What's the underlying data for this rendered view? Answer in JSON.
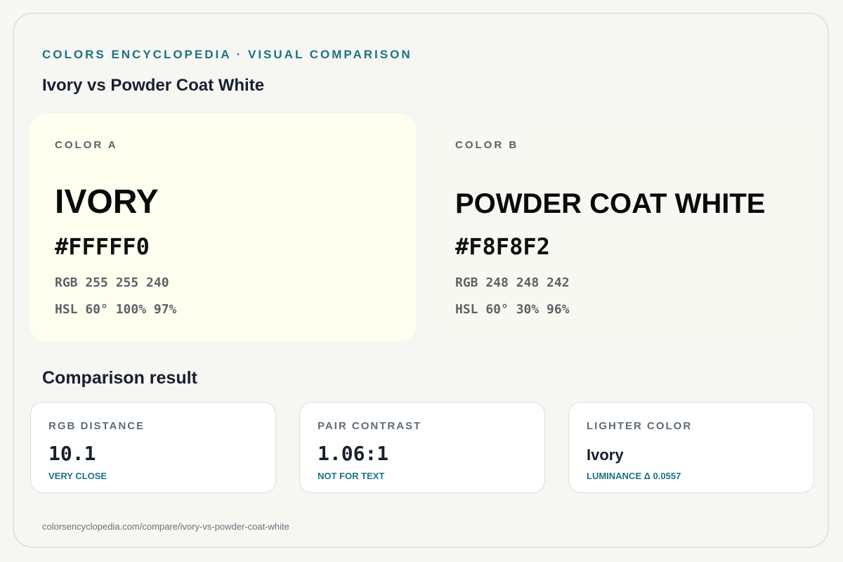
{
  "header": {
    "kicker": "COLORS ENCYCLOPEDIA · VISUAL COMPARISON",
    "title": "Ivory vs Powder Coat White"
  },
  "colors": [
    {
      "label": "COLOR A",
      "name": "IVORY",
      "hex": "#FFFFF0",
      "rgb": "RGB 255 255 240",
      "hsl": "HSL 60° 100% 97%",
      "swatch_color": "#FFFFF0"
    },
    {
      "label": "COLOR B",
      "name": "POWDER COAT WHITE",
      "hex": "#F8F8F2",
      "rgb": "RGB 248 248 242",
      "hsl": "HSL 60° 30% 96%",
      "swatch_color": "#F8F8F2"
    }
  ],
  "comparison": {
    "title": "Comparison result",
    "cards": [
      {
        "label": "RGB DISTANCE",
        "value": "10.1",
        "note": "VERY CLOSE"
      },
      {
        "label": "PAIR CONTRAST",
        "value": "1.06:1",
        "note": "NOT FOR TEXT"
      },
      {
        "label": "LIGHTER COLOR",
        "value": "Ivory",
        "note": "LUMINANCE Δ 0.0557"
      }
    ]
  },
  "footer": {
    "url": "colorsencyclopedia.com/compare/ivory-vs-powder-coat-white"
  },
  "theme": {
    "accent": "#1d7282",
    "background": "#f6f6f3"
  }
}
